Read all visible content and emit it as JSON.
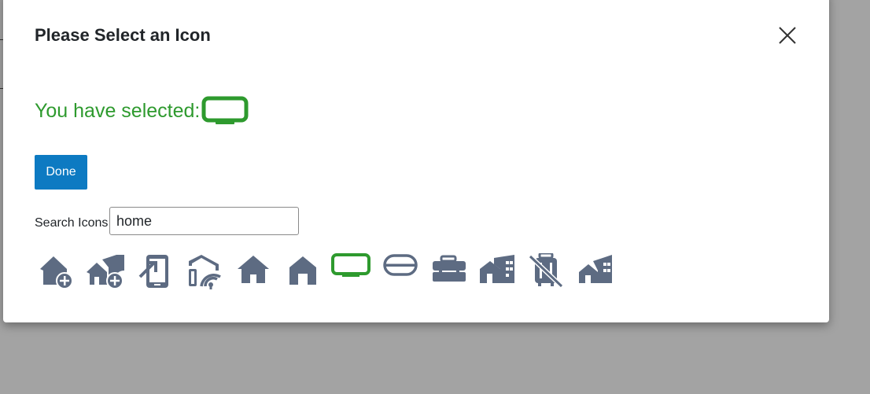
{
  "modal": {
    "title": "Please Select an Icon",
    "close_icon": "close-icon",
    "selected_label": "You have selected:",
    "selected_icon": "tv-icon",
    "done_label": "Done",
    "search_label": "Search Icons",
    "search_value": "home"
  },
  "icons": [
    {
      "name": "house-circle-plus-icon"
    },
    {
      "name": "houses-circle-plus-icon"
    },
    {
      "name": "mobile-arrow-in-icon"
    },
    {
      "name": "house-signal-icon"
    },
    {
      "name": "home-icon"
    },
    {
      "name": "home-outline-icon"
    },
    {
      "name": "tv-icon",
      "selected": true
    },
    {
      "name": "capsule-icon"
    },
    {
      "name": "toolbox-icon"
    },
    {
      "name": "building-house-icon"
    },
    {
      "name": "luggage-slash-icon"
    },
    {
      "name": "city-house-icon"
    }
  ],
  "colors": {
    "accent_green": "#2e9a2e",
    "icon_gray": "#5d6b82",
    "done_blue": "#0d7ac2",
    "overlay": "#a3a3a3"
  }
}
